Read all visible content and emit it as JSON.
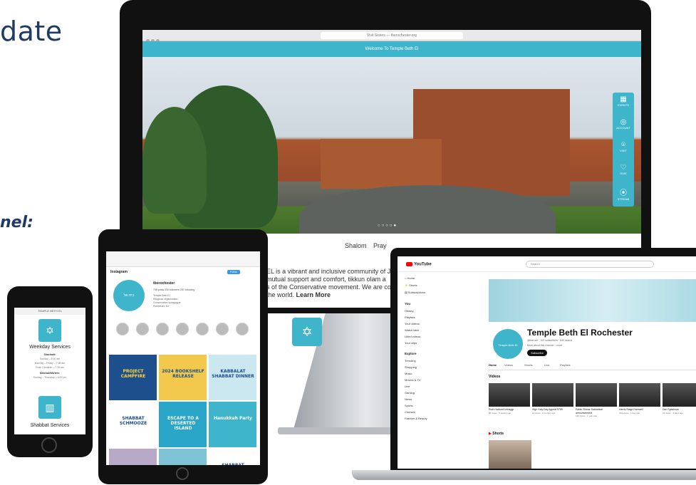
{
  "page": {
    "heading_fragment": "date",
    "channel_fragment": "nel:"
  },
  "desktop": {
    "browser_title": "Visit Sisters — tberochester.org",
    "welcome_banner": "Welcome To Temple Beth El",
    "side_panel": [
      {
        "label": "EVENTS",
        "icon": "calendar-icon"
      },
      {
        "label": "ACCOUNT",
        "icon": "user-icon"
      },
      {
        "label": "VISIT",
        "icon": "location-icon"
      },
      {
        "label": "GIVE",
        "icon": "heart-icon"
      },
      {
        "label": "STREAM",
        "icon": "broadcast-icon"
      }
    ],
    "nav": [
      "Shalom",
      "Pray"
    ],
    "intro_lines": [
      "EL is a vibrant and inclusive community of J",
      "mutual support and comfort, tikkun olam a",
      "s of the Conservative movement. We are co",
      "the world."
    ],
    "learn_more": "Learn More",
    "slider_dots": "○○○○●"
  },
  "phone": {
    "status": "TEMPLE BETH EL",
    "section1": {
      "title": "Weekday Services",
      "lines": [
        "Shacharit:",
        "Sunday – 8:00 am",
        "Monday – Friday – 7:00 am",
        "Rosh Chodesh – 7:15 am",
        "Minchah/Ma'ariv:",
        "Sunday – Thursday – 6:00 pm"
      ]
    },
    "section2": {
      "title": "Shabbat Services"
    }
  },
  "tablet": {
    "app": "Instagram",
    "handle": "tberochester",
    "follow": "Follow",
    "stats": "798 posts   930 followers   287 following",
    "bio": [
      "Temple Beth El",
      "Religious organization",
      "Conservative synagogue",
      "Rochester, NY"
    ],
    "grid": [
      {
        "text": "PROJECT CAMPFIRE",
        "bg": "#1d4f8c",
        "fg": "#ffd23a"
      },
      {
        "text": "2024 BOOKSHELF RELEASE",
        "bg": "#f2c94c",
        "fg": "#1d4f8c"
      },
      {
        "text": "KABBALAT SHABBAT DINNER",
        "bg": "#cbe7f0",
        "fg": "#1d4f8c"
      },
      {
        "text": "SHABBAT SCHMOOZE",
        "bg": "#ffffff",
        "fg": "#1d4f8c"
      },
      {
        "text": "ESCAPE TO A DESERTED ISLAND",
        "bg": "#2aa6c9",
        "fg": "#ffffff"
      },
      {
        "text": "Hanukkah Party",
        "bg": "#3fb5cc",
        "fg": "#ffffff"
      },
      {
        "text": "",
        "bg": "#b9a9c9",
        "fg": "#ffffff"
      },
      {
        "text": "",
        "bg": "#7ec3d6",
        "fg": "#ffffff"
      },
      {
        "text": "SHABBAT",
        "bg": "#ffffff",
        "fg": "#1d4f8c"
      }
    ]
  },
  "laptop": {
    "app": "YouTube",
    "search_placeholder": "Search",
    "sidebar": [
      {
        "label": "Home",
        "icon": "home-icon"
      },
      {
        "label": "Shorts",
        "icon": "shorts-icon"
      },
      {
        "label": "Subscriptions",
        "icon": "subscriptions-icon"
      }
    ],
    "you_label": "You",
    "you_items": [
      "History",
      "Playlists",
      "Your videos",
      "Watch later",
      "Liked videos",
      "Your clips"
    ],
    "explore_label": "Explore",
    "explore_items": [
      "Trending",
      "Shopping",
      "Music",
      "Movies & TV",
      "Live",
      "Gaming",
      "News",
      "Sports",
      "Courses",
      "Fashion & Beauty"
    ],
    "channel": {
      "name": "Temple Beth El Rochester",
      "meta": "@tberoch · 102 subscribers · 649 videos",
      "desc": "More about this channel ...more",
      "subscribe": "Subscribe",
      "avatar_text": "Temple Beth El"
    },
    "tabs": [
      "Home",
      "Videos",
      "Shorts",
      "Live",
      "Playlists"
    ],
    "videos_label": "Videos",
    "videos": [
      {
        "title": "Ruth Harbord Unhaggr",
        "meta": "85 views · 5 weeks ago"
      },
      {
        "title": "High Holy Day Appeal 5785",
        "meta": "11 views · 2 months ago"
      },
      {
        "title": "Rabbi Shivaz Sabbatical announcement",
        "meta": "140 views · 1 year ago"
      },
      {
        "title": "Harris Stage Farewell",
        "meta": "310 views · 1 day ago"
      },
      {
        "title": "Dan Spitalman",
        "meta": "18 views · 3 days ago"
      }
    ],
    "shorts_label": "Shorts"
  }
}
